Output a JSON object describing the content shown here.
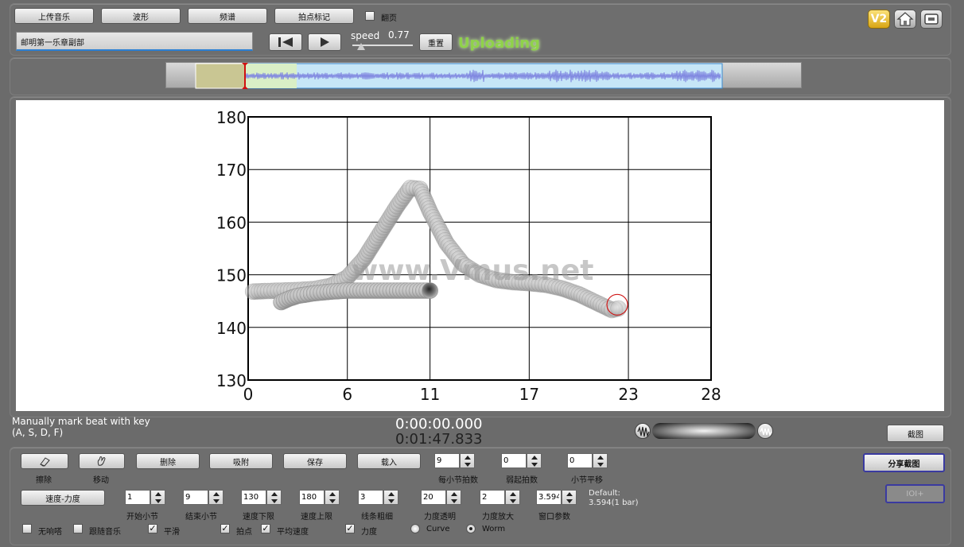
{
  "toolbar": {
    "upload_music": "上传音乐",
    "waveform": "波形",
    "spectrum": "频谱",
    "beat_marker": "拍点标记",
    "flip_page": "翻页",
    "song_title": "邮明第一乐章副部",
    "speed_label": "speed",
    "speed_value": "0.77",
    "speed_fraction": 0.15,
    "reset": "重置",
    "status": "Uploading",
    "v2": "V2"
  },
  "waveform_overview": {
    "colors": {
      "selection": "#bfe3f7",
      "played": "#d8f0c8",
      "marker": "#c9c693",
      "wave": "#7f86e0"
    }
  },
  "main_chart": {
    "watermark": "www.Vmus.net"
  },
  "chart_data": {
    "type": "scatter",
    "title": "",
    "xlabel": "",
    "ylabel": "",
    "xlim": [
      0,
      28
    ],
    "ylim": [
      130,
      180
    ],
    "xticks": [
      "0",
      "6",
      "11",
      "17",
      "23",
      "28"
    ],
    "yticks": [
      "180",
      "170",
      "160",
      "150",
      "140",
      "130"
    ],
    "grid": true,
    "series": [
      {
        "values": [
          [
            0.3,
            146.8
          ],
          [
            1,
            146.9
          ],
          [
            2,
            147.0
          ],
          [
            3,
            147.1
          ],
          [
            4,
            147.3
          ],
          [
            5,
            147.9
          ],
          [
            6,
            149.5
          ],
          [
            7,
            153
          ],
          [
            8,
            158
          ],
          [
            9,
            163
          ],
          [
            9.8,
            166.5
          ],
          [
            10.4,
            166.3
          ],
          [
            11,
            162
          ],
          [
            12,
            156
          ],
          [
            13,
            152
          ],
          [
            14,
            150
          ],
          [
            15,
            149
          ],
          [
            16,
            148.6
          ],
          [
            17,
            148.4
          ],
          [
            18,
            148.1
          ],
          [
            19,
            147.4
          ],
          [
            20,
            146.3
          ],
          [
            21,
            144.8
          ],
          [
            22,
            143.3
          ],
          [
            22.4,
            143.6
          ]
        ]
      },
      {
        "values": [
          [
            2,
            144.8
          ],
          [
            2.5,
            145.5
          ],
          [
            3,
            146
          ],
          [
            4,
            146.5
          ],
          [
            5,
            146.8
          ],
          [
            6,
            147
          ],
          [
            7,
            147
          ],
          [
            8,
            147
          ],
          [
            9,
            147
          ],
          [
            10,
            147
          ],
          [
            11,
            147
          ]
        ]
      }
    ],
    "cursor": [
      23,
      144
    ]
  },
  "status_area": {
    "hint_line1": "Manually mark beat with key",
    "hint_line2": "(A, S, D, F)",
    "time_current": "0:00:00.000",
    "time_total": "0:01:47.833",
    "screenshot_button": "截图"
  },
  "controls": {
    "erase": "擦除",
    "move": "移动",
    "delete": "删除",
    "adsorb": "吸附",
    "save": "保存",
    "load": "载入",
    "beats_per_bar": {
      "label": "每小节拍数",
      "value": "9"
    },
    "pickup_beats": {
      "label": "弱起拍数",
      "value": "0"
    },
    "bar_shift": {
      "label": "小节平移",
      "value": "0"
    },
    "share_screenshot": "分享截图",
    "ioi_button": "IOI+",
    "speed_dynamics": "速度-力度",
    "start_bar": {
      "label": "开始小节",
      "value": "1"
    },
    "end_bar": {
      "label": "结束小节",
      "value": "9"
    },
    "speed_min": {
      "label": "速度下限",
      "value": "130"
    },
    "speed_max": {
      "label": "速度上限",
      "value": "180"
    },
    "line_width": {
      "label": "线条粗细",
      "value": "3"
    },
    "dyn_opacity": {
      "label": "力度透明",
      "value": "20"
    },
    "dyn_scale": {
      "label": "力度放大",
      "value": "2"
    },
    "window_param": {
      "label": "窗口参数",
      "value": "3.594"
    },
    "default_note_1": "Default:",
    "default_note_2": "3.594(1 bar)",
    "opt_silent": "无响嗒",
    "opt_follow": "跟随音乐",
    "opt_smooth": "平滑",
    "opt_beat": "拍点",
    "opt_avg_speed": "平均速度",
    "opt_dynamics": "力度",
    "opt_curve": "Curve",
    "opt_worm": "Worm"
  }
}
